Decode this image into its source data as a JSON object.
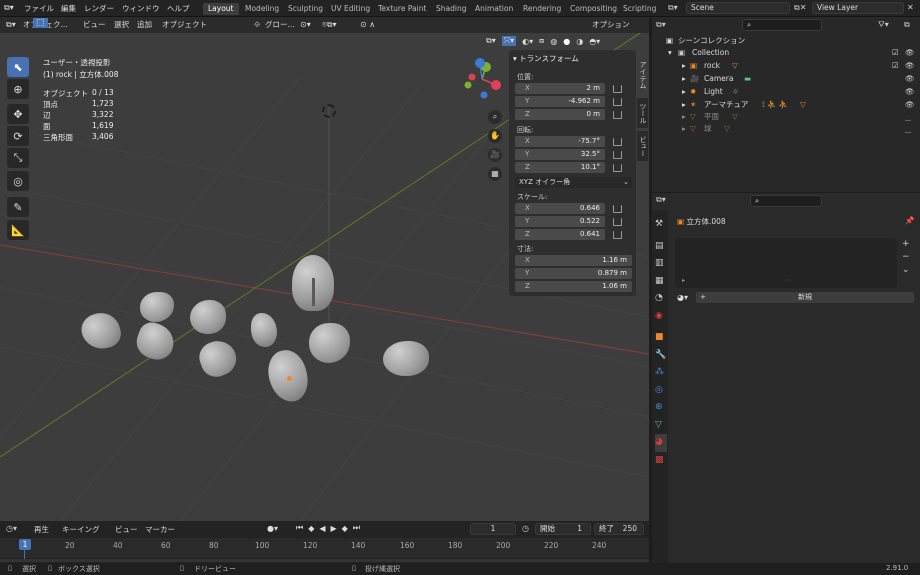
{
  "menubar": {
    "items": [
      "ファイル",
      "編集",
      "レンダー",
      "ウィンドウ",
      "ヘルプ"
    ],
    "workspaces": [
      "Layout",
      "Modeling",
      "Sculpting",
      "UV Editing",
      "Texture Paint",
      "Shading",
      "Animation",
      "Rendering",
      "Compositing",
      "Scripting"
    ],
    "active_workspace": "Layout",
    "scene": "Scene",
    "view_layer": "View Layer"
  },
  "viewport_header": {
    "mode": "オブジェク...",
    "menus": [
      "ビュー",
      "選択",
      "追加",
      "オブジェクト"
    ],
    "transform_orientation": "グロー...",
    "options": "オプション"
  },
  "viewport_info": {
    "view_name": "ユーザー・透視投影",
    "object_name": "(1) rock | 立方体.008",
    "stats": [
      {
        "label": "オブジェクト",
        "value": "0 / 13"
      },
      {
        "label": "頂点",
        "value": "1,723"
      },
      {
        "label": "辺",
        "value": "3,322"
      },
      {
        "label": "面",
        "value": "1,619"
      },
      {
        "label": "三角形面",
        "value": "3,406"
      }
    ]
  },
  "transform_panel": {
    "title": "トランスフォーム",
    "location_label": "位置:",
    "location": [
      {
        "axis": "X",
        "value": "2 m"
      },
      {
        "axis": "Y",
        "value": "-4.962 m"
      },
      {
        "axis": "Z",
        "value": "0 m"
      }
    ],
    "rotation_label": "回転:",
    "rotation": [
      {
        "axis": "X",
        "value": "-75.7°"
      },
      {
        "axis": "Y",
        "value": "32.5°"
      },
      {
        "axis": "Z",
        "value": "10.1°"
      }
    ],
    "rotation_mode": "XYZ オイラー角",
    "scale_label": "スケール:",
    "scale": [
      {
        "axis": "X",
        "value": "0.646"
      },
      {
        "axis": "Y",
        "value": "0.522"
      },
      {
        "axis": "Z",
        "value": "0.641"
      }
    ],
    "dimensions_label": "寸法:",
    "dimensions": [
      {
        "axis": "X",
        "value": "1.16 m"
      },
      {
        "axis": "Y",
        "value": "0.879 m"
      },
      {
        "axis": "Z",
        "value": "1.06 m"
      }
    ],
    "side_tabs": [
      "アイテム",
      "ツール",
      "ビュー"
    ]
  },
  "outliner": {
    "root": "シーンコレクション",
    "items": [
      {
        "name": "Collection",
        "indent": 0
      },
      {
        "name": "rock",
        "indent": 1
      },
      {
        "name": "Camera",
        "indent": 1
      },
      {
        "name": "Light",
        "indent": 1
      },
      {
        "name": "アーマチュア",
        "indent": 1
      },
      {
        "name": "平面",
        "indent": 1
      },
      {
        "name": "球",
        "indent": 1
      }
    ]
  },
  "properties": {
    "object_name": "立方体.008",
    "new_button": "新規"
  },
  "timeline": {
    "menus": [
      "再生",
      "キーイング",
      "ビュー",
      "マーカー"
    ],
    "current_frame": "1",
    "start_label": "開始",
    "start": "1",
    "end_label": "終了",
    "end": "250",
    "ticks": [
      "1",
      "20",
      "40",
      "60",
      "80",
      "100",
      "120",
      "140",
      "160",
      "180",
      "200",
      "220",
      "240"
    ]
  },
  "statusbar": {
    "select": "選択",
    "box_select": "ボックス選択",
    "dolly": "ドリービュー",
    "lasso": "投げ縄選択",
    "version": "2.91.0"
  },
  "colors": {
    "accent": "#4772b3",
    "axis_x": "#e0405a",
    "axis_y": "#7bb135",
    "axis_z": "#3c7ad8"
  }
}
